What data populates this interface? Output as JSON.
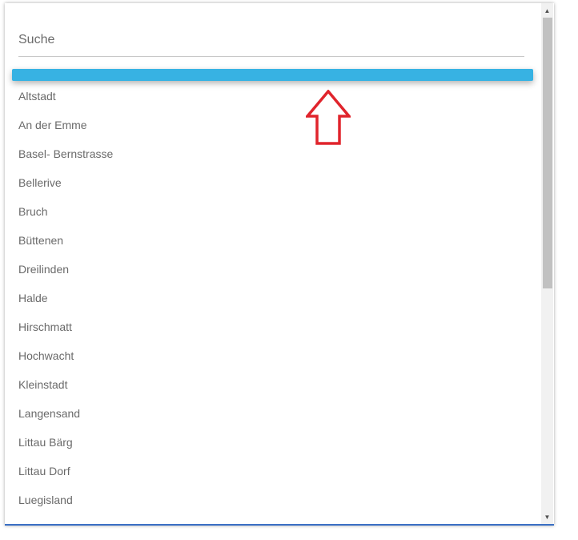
{
  "search": {
    "placeholder": "Suche",
    "value": ""
  },
  "list": {
    "items": [
      "Altstadt",
      "An der Emme",
      "Basel- Bernstrasse",
      "Bellerive",
      "Bruch",
      "Büttenen",
      "Dreilinden",
      "Halde",
      "Hirschmatt",
      "Hochwacht",
      "Kleinstadt",
      "Langensand",
      "Littau Bärg",
      "Littau Dorf",
      "Luegisland"
    ]
  },
  "colors": {
    "highlight": "#37b2e3",
    "arrow": "#e0242c",
    "underline": "#3a6fc4"
  },
  "icons": {
    "annotation": "up-arrow-icon",
    "scroll_up": "triangle-up-icon",
    "scroll_down": "triangle-down-icon"
  }
}
